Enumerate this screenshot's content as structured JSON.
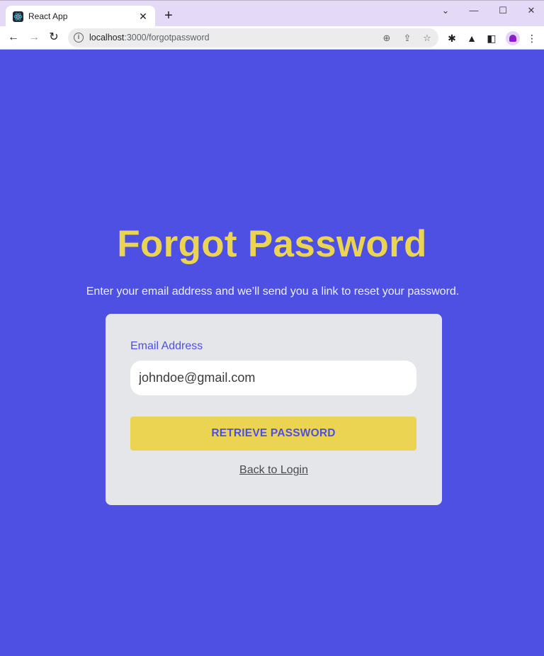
{
  "browser": {
    "tab_title": "React App",
    "url_host": "localhost",
    "url_path": ":3000/forgotpassword",
    "icons": {
      "favicon": "react-logo-icon",
      "tab_close": "close-icon",
      "new_tab": "plus-icon",
      "tab_search": "chevron-down-icon",
      "minimize": "minimize-icon",
      "maximize": "maximize-icon",
      "close_window": "close-icon",
      "back": "arrow-left-icon",
      "forward": "arrow-right-icon",
      "reload": "reload-icon",
      "site_info": "info-icon",
      "zoom": "zoom-in-icon",
      "share": "share-icon",
      "bookmark": "star-icon",
      "extensions": "puzzle-icon",
      "labs": "flask-icon",
      "side_panel": "side-panel-icon",
      "profile": "profile-icon",
      "menu": "kebab-menu-icon"
    },
    "glyphs": {
      "tab_close": "✕",
      "new_tab": "+",
      "tab_search": "⌄",
      "minimize": "—",
      "maximize": "☐",
      "close_window": "✕",
      "back": "←",
      "forward": "→",
      "reload": "↻",
      "site_info": "i",
      "zoom": "⊕",
      "share": "⇪",
      "bookmark": "☆",
      "extensions": "✱",
      "labs": "▲",
      "side_panel": "◧",
      "menu": "⋮"
    }
  },
  "page": {
    "title": "Forgot Password",
    "subtitle": "Enter your email address and we’ll send you a link to reset your password.",
    "form": {
      "email_label": "Email Address",
      "email_value": "johndoe@gmail.com",
      "submit_label": "RETRIEVE PASSWORD",
      "back_link": "Back to Login"
    }
  },
  "colors": {
    "background": "#4d50e3",
    "accent": "#ead451",
    "card": "#e4e6ea"
  }
}
